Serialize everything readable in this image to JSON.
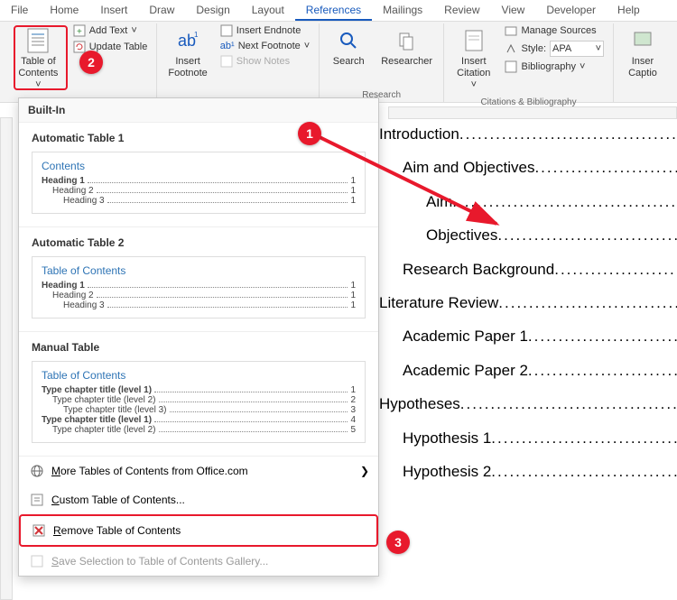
{
  "menu": [
    "File",
    "Home",
    "Insert",
    "Draw",
    "Design",
    "Layout",
    "References",
    "Mailings",
    "Review",
    "View",
    "Developer",
    "Help"
  ],
  "menu_active_index": 6,
  "ribbon": {
    "toc": {
      "label": "Table of\nContents"
    },
    "add_text": "Add Text",
    "update_table": "Update Table",
    "insert_footnote": "Insert\nFootnote",
    "insert_endnote": "Insert Endnote",
    "next_footnote": "Next Footnote",
    "show_notes": "Show Notes",
    "search": "Search",
    "researcher": "Researcher",
    "research_group": "Research",
    "insert_citation": "Insert\nCitation",
    "manage_sources": "Manage Sources",
    "style": "Style:",
    "style_value": "APA",
    "bibliography": "Bibliography",
    "citations_group": "Citations & Bibliography",
    "insert_caption": "Insert\nCaption"
  },
  "dropdown": {
    "builtin": "Built-In",
    "items": [
      {
        "title": "Automatic Table 1",
        "preview_title": "Contents",
        "rows": [
          {
            "label": "Heading 1",
            "page": "1",
            "indent": 0
          },
          {
            "label": "Heading 2",
            "page": "1",
            "indent": 1
          },
          {
            "label": "Heading 3",
            "page": "1",
            "indent": 2
          }
        ]
      },
      {
        "title": "Automatic Table 2",
        "preview_title": "Table of Contents",
        "rows": [
          {
            "label": "Heading 1",
            "page": "1",
            "indent": 0
          },
          {
            "label": "Heading 2",
            "page": "1",
            "indent": 1
          },
          {
            "label": "Heading 3",
            "page": "1",
            "indent": 2
          }
        ]
      },
      {
        "title": "Manual Table",
        "preview_title": "Table of Contents",
        "rows": [
          {
            "label": "Type chapter title (level 1)",
            "page": "1",
            "indent": 0
          },
          {
            "label": "Type chapter title (level 2)",
            "page": "2",
            "indent": 1
          },
          {
            "label": "Type chapter title (level 3)",
            "page": "3",
            "indent": 2
          },
          {
            "label": "Type chapter title (level 1)",
            "page": "4",
            "indent": 0
          },
          {
            "label": "Type chapter title (level 2)",
            "page": "5",
            "indent": 1
          }
        ]
      }
    ],
    "more": "More Tables of Contents from Office.com",
    "custom": "Custom Table of Contents...",
    "remove": "Remove Table of Contents",
    "save_selection": "Save Selection to Table of Contents Gallery..."
  },
  "callouts": {
    "c1": "1",
    "c2": "2",
    "c3": "3"
  },
  "document": [
    {
      "text": "Introduction",
      "indent": 0
    },
    {
      "text": "Aim and Objectives",
      "indent": 1
    },
    {
      "text": "Aim",
      "indent": 2
    },
    {
      "text": "Objectives",
      "indent": 2
    },
    {
      "text": "Research Background",
      "indent": 1
    },
    {
      "text": "Literature Review",
      "indent": 0
    },
    {
      "text": "Academic Paper 1",
      "indent": 1
    },
    {
      "text": "Academic Paper 2",
      "indent": 1
    },
    {
      "text": "Hypotheses",
      "indent": 0
    },
    {
      "text": "Hypothesis 1",
      "indent": 1
    },
    {
      "text": "Hypothesis 2",
      "indent": 1
    }
  ]
}
